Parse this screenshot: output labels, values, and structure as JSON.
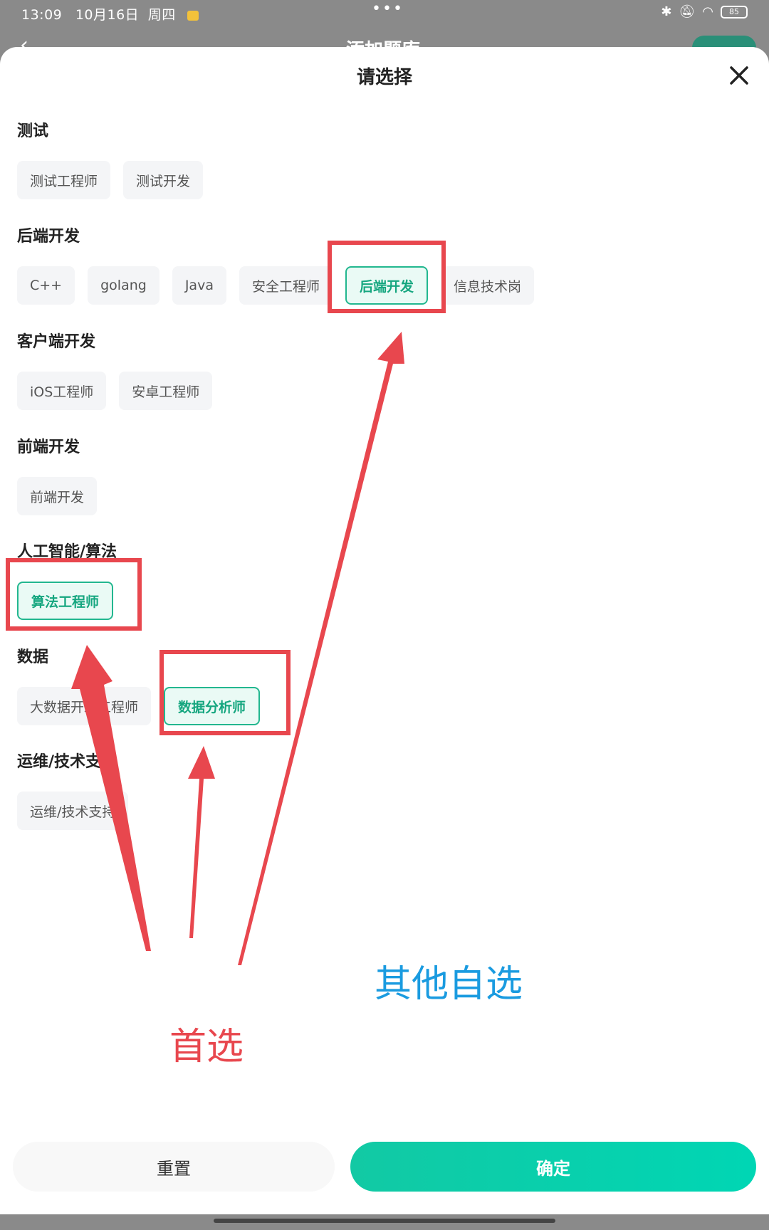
{
  "status_bar": {
    "time": "13:09",
    "date": "10月16日",
    "weekday": "周四",
    "center_dots": "•••",
    "battery": "85"
  },
  "background_page": {
    "title": "添加题库",
    "back_icon": "chevron-left-icon"
  },
  "sheet": {
    "title": "请选择",
    "close_icon": "close-icon",
    "categories": [
      {
        "title": "测试",
        "options": [
          {
            "label": "测试工程师",
            "selected": false
          },
          {
            "label": "测试开发",
            "selected": false
          }
        ]
      },
      {
        "title": "后端开发",
        "options": [
          {
            "label": "C++",
            "selected": false
          },
          {
            "label": "golang",
            "selected": false
          },
          {
            "label": "Java",
            "selected": false
          },
          {
            "label": "安全工程师",
            "selected": false
          },
          {
            "label": "后端开发",
            "selected": true
          },
          {
            "label": "信息技术岗",
            "selected": false
          }
        ]
      },
      {
        "title": "客户端开发",
        "options": [
          {
            "label": "iOS工程师",
            "selected": false
          },
          {
            "label": "安卓工程师",
            "selected": false
          }
        ]
      },
      {
        "title": "前端开发",
        "options": [
          {
            "label": "前端开发",
            "selected": false
          }
        ]
      },
      {
        "title": "人工智能/算法",
        "options": [
          {
            "label": "算法工程师",
            "selected": true
          }
        ]
      },
      {
        "title": "数据",
        "options": [
          {
            "label": "大数据开发工程师",
            "selected": false
          },
          {
            "label": "数据分析师",
            "selected": true
          }
        ]
      },
      {
        "title": "运维/技术支持",
        "options": [
          {
            "label": "运维/技术支持",
            "selected": false
          }
        ]
      }
    ],
    "reset_label": "重置",
    "confirm_label": "确定"
  },
  "annotations": {
    "primary_label": "首选",
    "other_label": "其他自选",
    "highlight_color": "#e8474e",
    "other_color": "#1a9be0"
  },
  "colors": {
    "accent": "#22b78f",
    "confirm_gradient_start": "#12c9a4",
    "confirm_gradient_end": "#00d6b4"
  }
}
